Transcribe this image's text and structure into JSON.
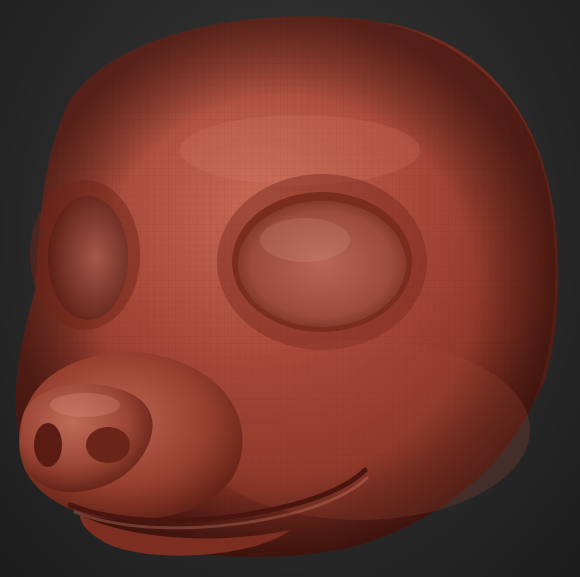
{
  "scene": {
    "subject": "sculpted-animal-head-model",
    "colors": {
      "background": "#2a2a2a",
      "clay_base": "#9a3c2c",
      "clay_light": "#c96a56",
      "clay_shadow": "#4e1a12",
      "wire_mesh": "#7a2e22"
    }
  }
}
